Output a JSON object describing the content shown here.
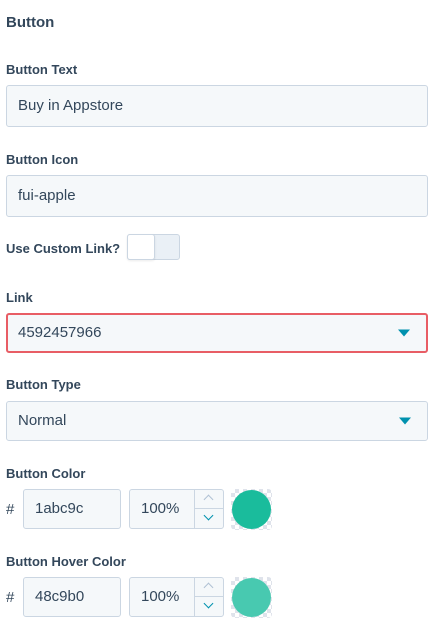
{
  "section": {
    "title": "Button"
  },
  "button_text": {
    "label": "Button Text",
    "value": "Buy in Appstore"
  },
  "button_icon": {
    "label": "Button Icon",
    "value": "fui-apple"
  },
  "custom_link": {
    "label": "Use Custom Link?",
    "enabled": false
  },
  "link": {
    "label": "Link",
    "value": "4592457966",
    "state": "error"
  },
  "button_type": {
    "label": "Button Type",
    "value": "Normal"
  },
  "button_color": {
    "label": "Button Color",
    "hash": "#",
    "hex": "1abc9c",
    "opacity": "100%",
    "swatch": "#1abc9c"
  },
  "button_hover_color": {
    "label": "Button Hover Color",
    "hash": "#",
    "hex": "48c9b0",
    "opacity": "100%",
    "swatch": "#48c9b0"
  },
  "colors": {
    "text": "#33475b",
    "error_border": "#e85d65",
    "caret": "#0091ae",
    "input_bg": "#f5f8fa"
  },
  "icons": [
    "chevron-down-icon",
    "chevron-up-icon"
  ]
}
